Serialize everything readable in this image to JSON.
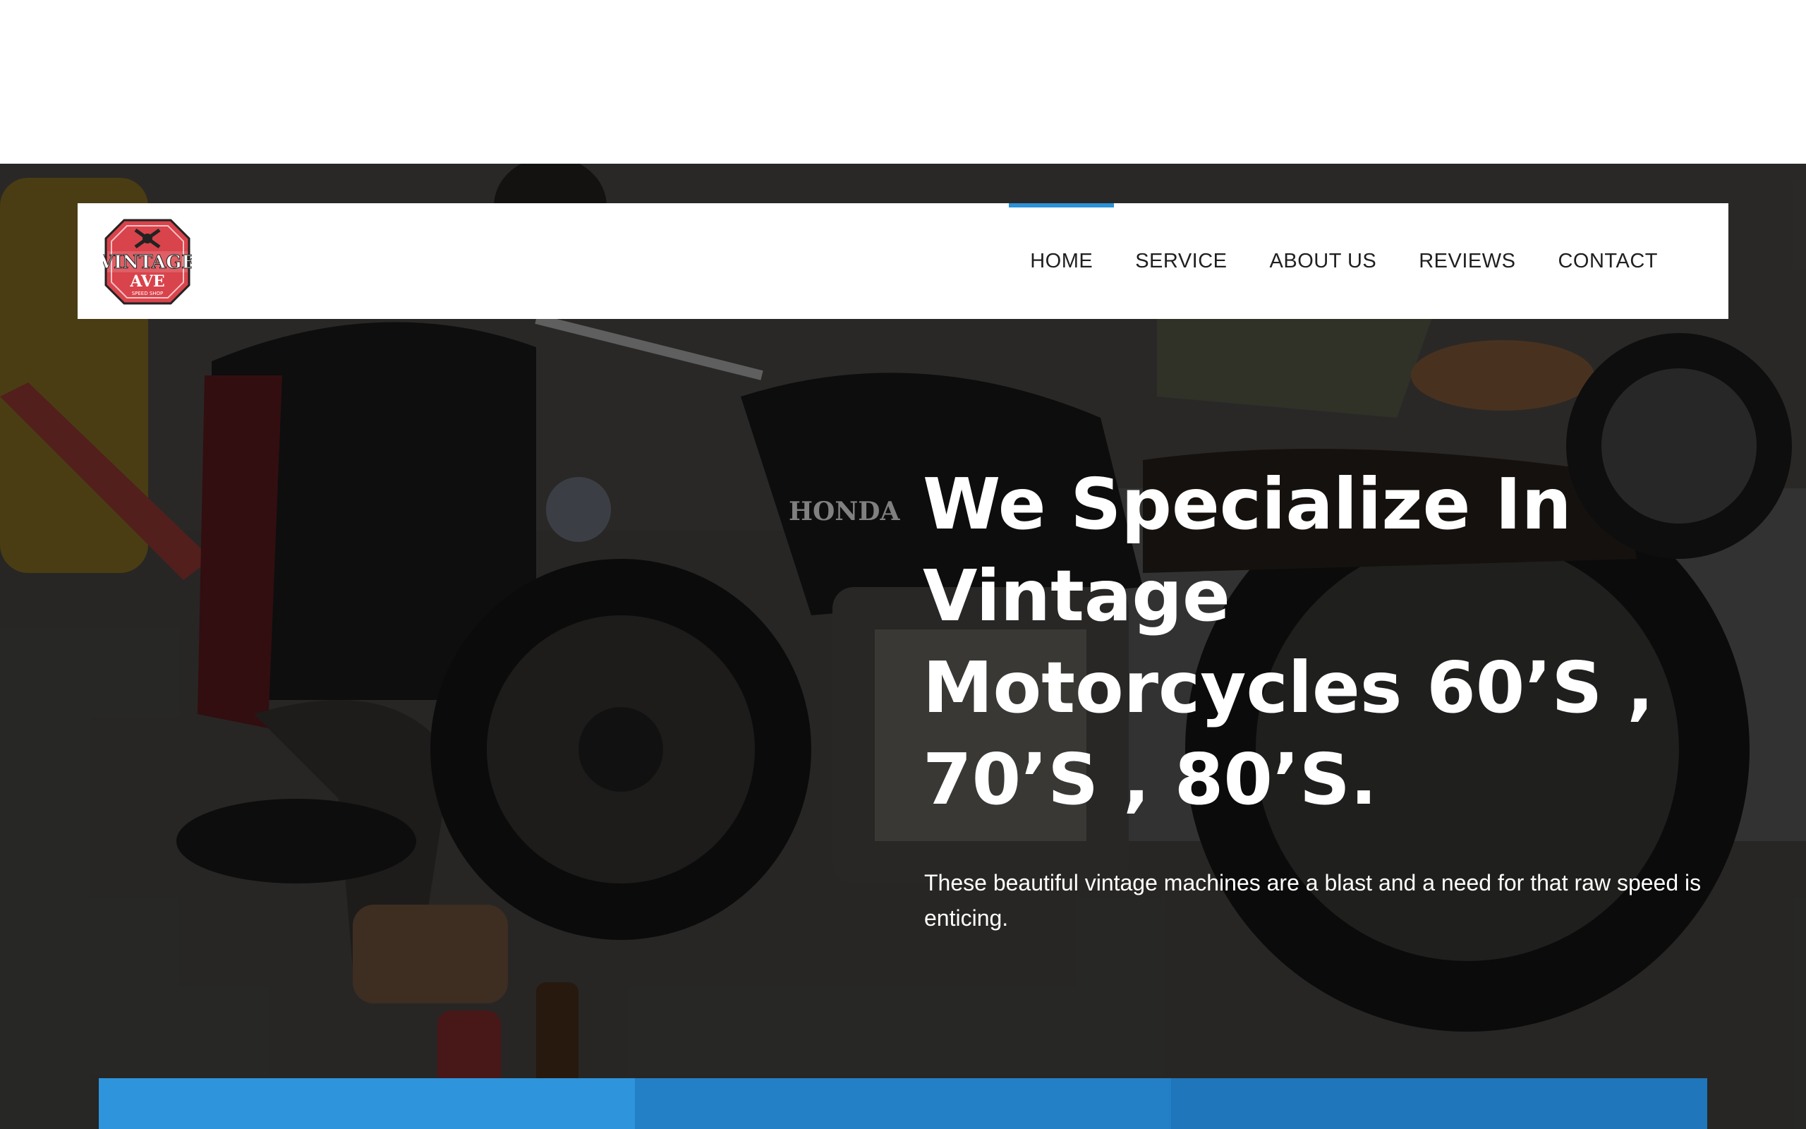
{
  "logo": {
    "line1": "VINTAGE",
    "line2": "AVE",
    "line3": "SPEED SHOP"
  },
  "nav": {
    "items": [
      {
        "label": "HOME",
        "active": true
      },
      {
        "label": "SERVICE",
        "active": false
      },
      {
        "label": "ABOUT US",
        "active": false
      },
      {
        "label": "REVIEWS",
        "active": false
      },
      {
        "label": "CONTACT",
        "active": false
      }
    ]
  },
  "hero": {
    "title_lines": [
      "We Specialize In",
      "Vintage",
      "Motorcycles 60’S ,",
      "70’S , 80’S."
    ],
    "subtitle": "These beautiful vintage machines are a blast and a need for that raw speed is enticing.",
    "tank_text": "HONDA"
  },
  "colors": {
    "accent": "#2a92d8",
    "bar1": "#2e94dc",
    "bar2": "#2380c6",
    "bar3": "#1f76ba"
  }
}
